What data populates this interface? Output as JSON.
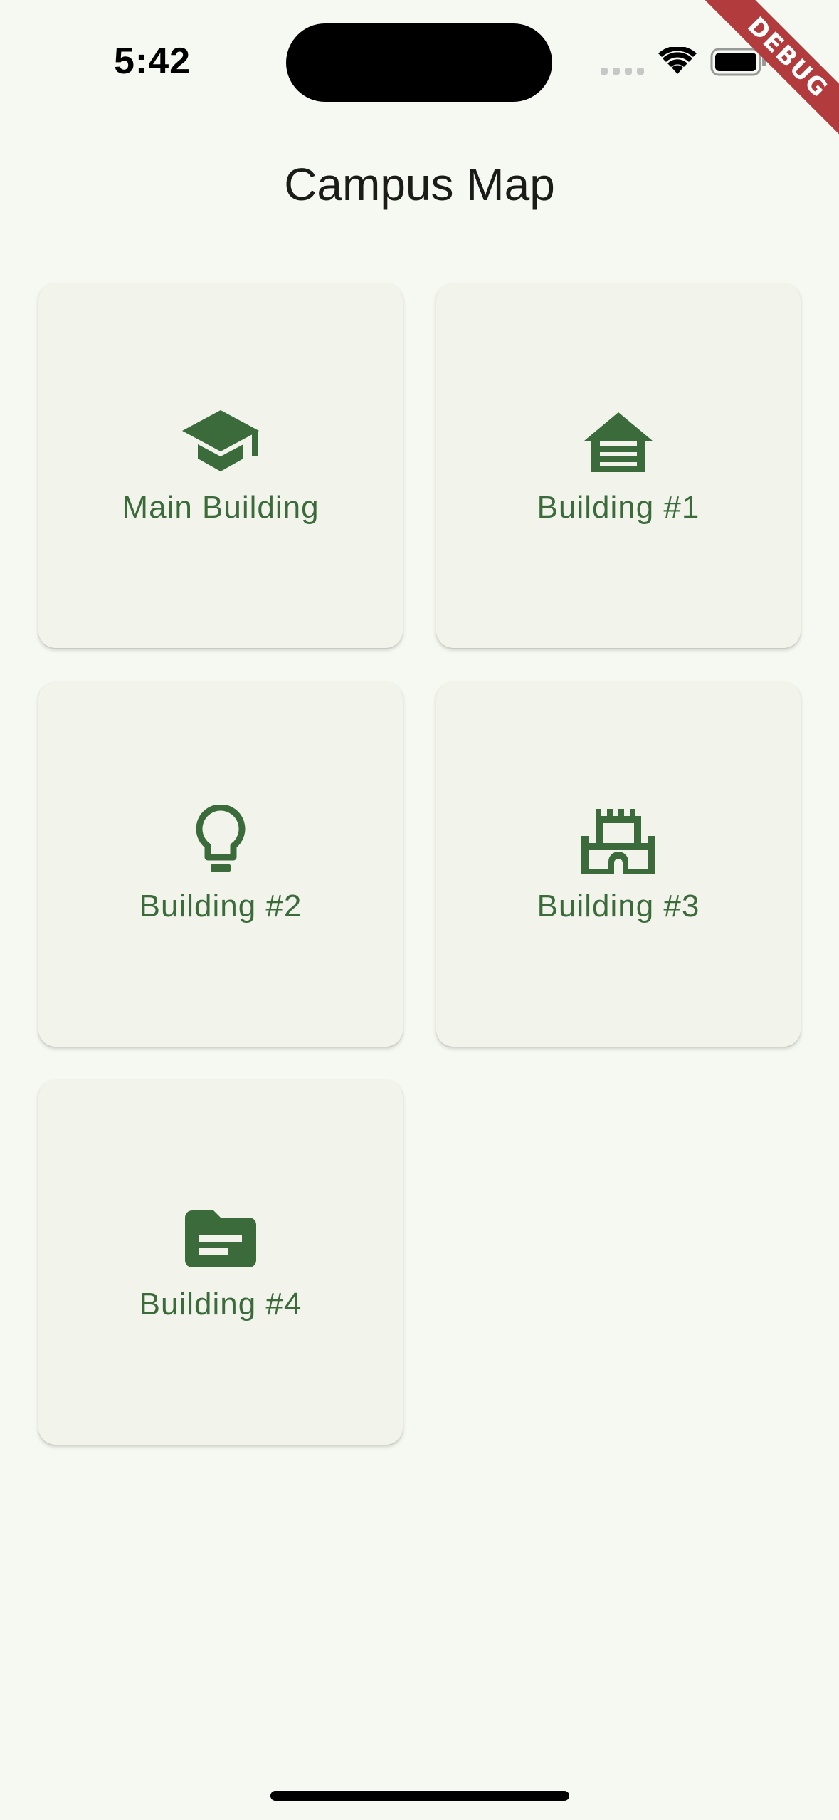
{
  "status_bar": {
    "time": "5:42"
  },
  "debug_banner": "DEBUG",
  "title": "Campus Map",
  "accent_color": "#3b6b3a",
  "cards": [
    {
      "label": "Main Building",
      "icon": "school-icon"
    },
    {
      "label": "Building #1",
      "icon": "garage-icon"
    },
    {
      "label": "Building #2",
      "icon": "lightbulb-icon"
    },
    {
      "label": "Building #3",
      "icon": "castle-icon"
    },
    {
      "label": "Building #4",
      "icon": "topic-folder-icon"
    }
  ]
}
